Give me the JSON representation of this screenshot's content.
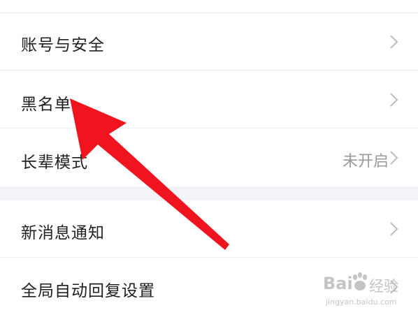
{
  "settings": {
    "account_security": {
      "label": "账号与安全"
    },
    "blacklist": {
      "label": "黑名单"
    },
    "elder_mode": {
      "label": "长辈模式",
      "value": "未开启"
    },
    "new_message_notification": {
      "label": "新消息通知"
    },
    "global_auto_reply": {
      "label": "全局自动回复设置"
    }
  },
  "watermark": {
    "brand_text": "Bai",
    "logo_text": "经验",
    "url": "jingyan.baidu.com"
  },
  "colors": {
    "arrow": "#f0141e",
    "chevron": "#bdbdbd",
    "section_gap": "#f4f4f8"
  },
  "icons": {
    "chevron": "chevron-right-icon",
    "arrow": "red-pointer-arrow"
  }
}
